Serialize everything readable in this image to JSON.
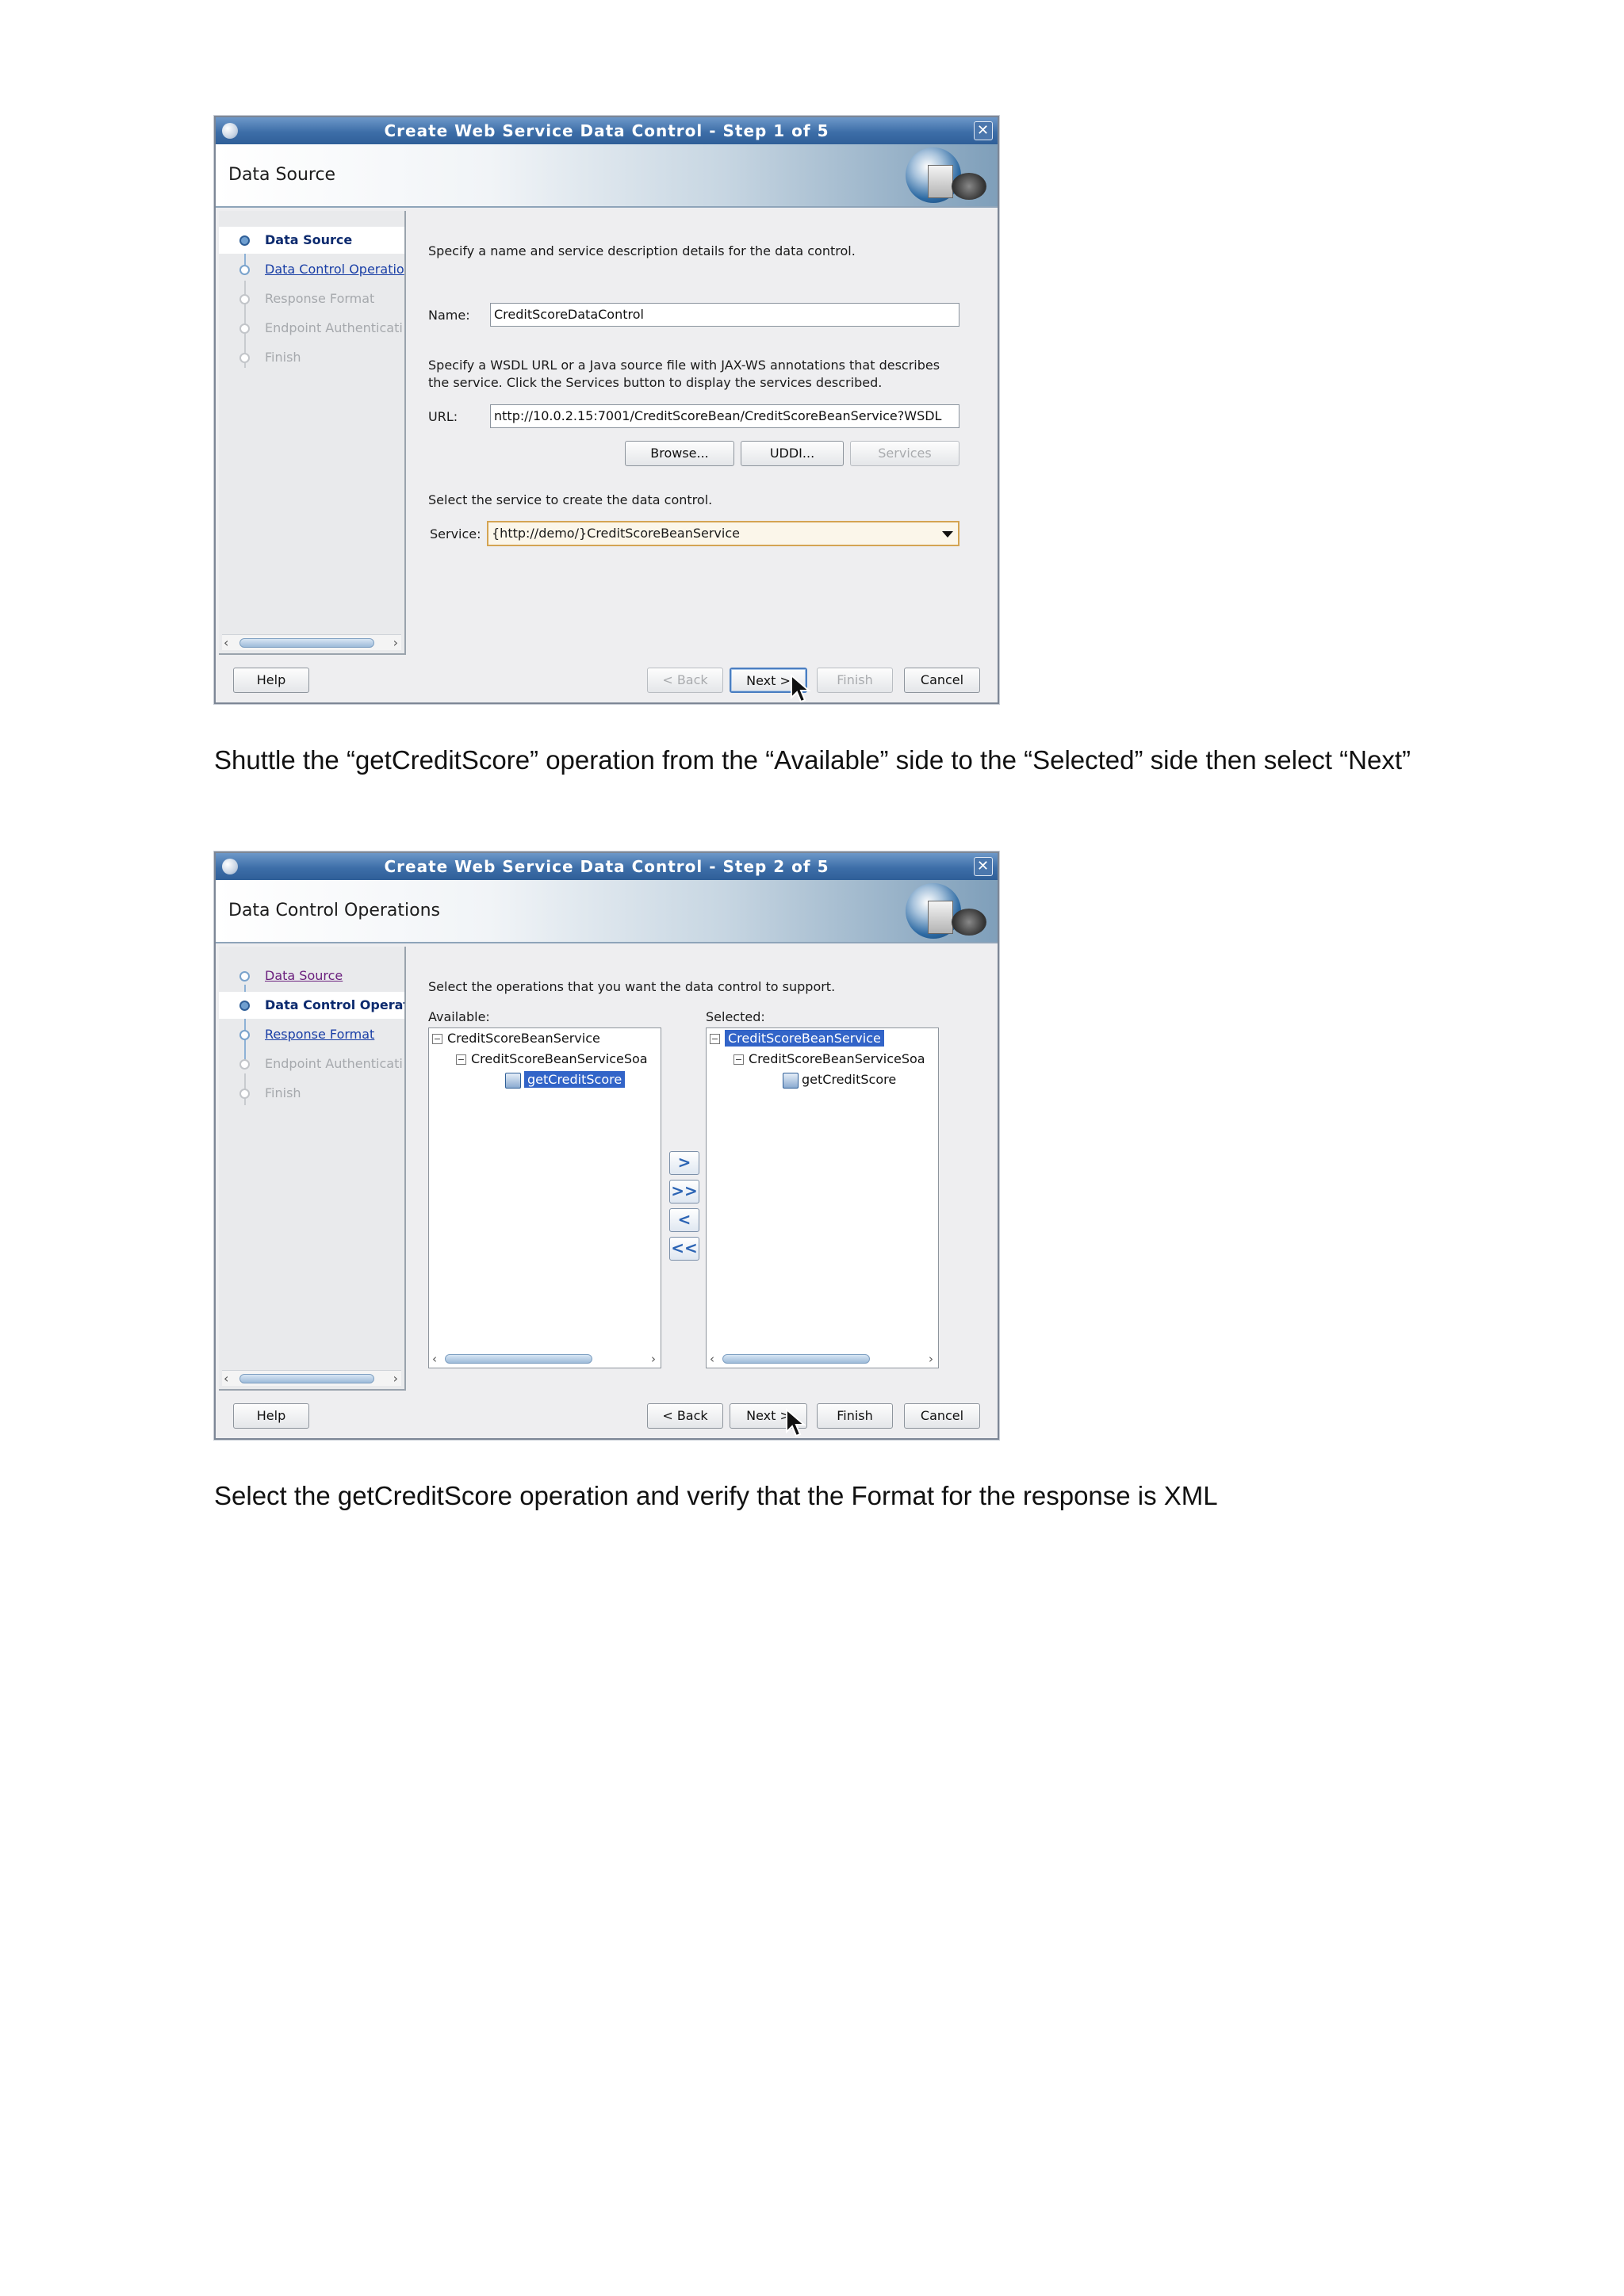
{
  "step1": {
    "title": "Create Web Service Data Control - Step 1 of 5",
    "banner": "Data Source",
    "steps": [
      "Data Source",
      "Data Control Operatio",
      "Response Format",
      "Endpoint Authenticati",
      "Finish"
    ],
    "intro": "Specify a name and service description details for the data control.",
    "name_label": "Name:",
    "name_value": "CreditScoreDataControl",
    "wsdl_text_1": "Specify a WSDL URL or a Java source file with JAX-WS annotations that describes",
    "wsdl_text_2": "the service. Click the Services button to display the services described.",
    "url_label": "URL:",
    "url_value": "nttp://10.0.2.15:7001/CreditScoreBean/CreditScoreBeanService?WSDL",
    "browse_label": "Browse...",
    "uddi_label": "UDDI...",
    "services_label": "Services",
    "select_service_text": "Select the service to create the data control.",
    "service_label": "Service:",
    "service_value": "{http://demo/}CreditScoreBeanService",
    "help_label": "Help",
    "back_label": "< Back",
    "next_label": "Next >",
    "finish_label": "Finish",
    "cancel_label": "Cancel"
  },
  "caption1": "Shuttle the “getCreditScore” operation from the “Available” side to the “Selected” side then select “Next”",
  "step2": {
    "title": "Create Web Service Data Control - Step 2 of 5",
    "banner": "Data Control Operations",
    "steps": [
      "Data Source",
      "Data Control Operati",
      "Response Format",
      "Endpoint Authenticati",
      "Finish"
    ],
    "intro": "Select the operations that you want the data control to support.",
    "available_label": "Available:",
    "selected_label": "Selected:",
    "available_tree": [
      "CreditScoreBeanService",
      "CreditScoreBeanServiceSoa",
      "getCreditScore"
    ],
    "selected_tree": [
      "CreditScoreBeanService",
      "CreditScoreBeanServiceSoa",
      "getCreditScore"
    ],
    "shuttle_buttons": [
      ">",
      ">>",
      "<",
      "<<"
    ],
    "help_label": "Help",
    "back_label": "< Back",
    "next_label": "Next >",
    "finish_label": "Finish",
    "cancel_label": "Cancel"
  },
  "caption2": "Select the getCreditScore operation and verify that the Format for the response is XML",
  "icons": [
    "window-icon",
    "close-icon",
    "mouse-cursor-icon",
    "operation-icon",
    "expander-icon"
  ],
  "colors": {
    "titlebar": "#3d6ea8",
    "selection": "#3264c8",
    "combo_border": "#d4a453"
  }
}
